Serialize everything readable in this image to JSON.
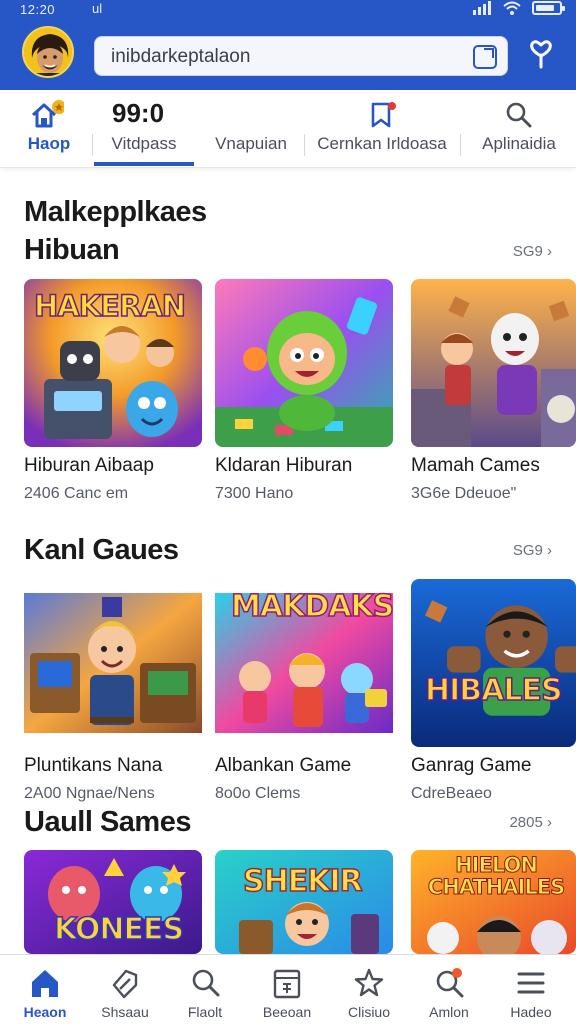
{
  "status": {
    "time": "12:20",
    "signal_left": "ul"
  },
  "search": {
    "value": "inibdarkeptalaon"
  },
  "tabs": [
    {
      "label": "Haop"
    },
    {
      "label": "Vitdpass",
      "big": "99:0"
    },
    {
      "label": "Vnapuian"
    },
    {
      "label": "Cernkan Irldoasa"
    },
    {
      "label": "Aplinaidia"
    }
  ],
  "page": {
    "title": "Malkepplkaes"
  },
  "sections": [
    {
      "title": "Hibuan",
      "see_all": "SG9 ›",
      "cards": [
        {
          "name": "Hiburan Aibaap",
          "meta": "2406 Canc em",
          "art_text": "HAKERAN"
        },
        {
          "name": "Kldaran Hiburan",
          "meta": "7300 Hano",
          "art_text": ""
        },
        {
          "name": "Mamah Cames",
          "meta": "3G6e Ddeuoe\"",
          "art_text": ""
        }
      ]
    },
    {
      "title": "Kanl Gaues",
      "see_all": "SG9 ›",
      "cards": [
        {
          "name": "Pluntikans Nana",
          "meta": "2A00 Ngnae/Nens",
          "art_text": ""
        },
        {
          "name": "Albankan Game",
          "meta": "8o0o Clems",
          "art_text": "MAKDAKS"
        },
        {
          "name": "Ganrag Game",
          "meta": "CdreBeaeo",
          "art_text": "HIBALES"
        }
      ]
    },
    {
      "title": "Uaull Sames",
      "see_all": "2805 ›",
      "cards": [
        {
          "name": "",
          "meta": "",
          "art_text": "KONEES"
        },
        {
          "name": "",
          "meta": "",
          "art_text": "SHEKIR"
        },
        {
          "name": "",
          "meta": "",
          "art_text": "HIELON CHATHAILES"
        }
      ]
    }
  ],
  "bottom_nav": [
    {
      "label": "Heaon",
      "icon": "home-icon"
    },
    {
      "label": "Shsaau",
      "icon": "tag-icon"
    },
    {
      "label": "Flaolt",
      "icon": "search-icon"
    },
    {
      "label": "Beeoan",
      "icon": "box-icon"
    },
    {
      "label": "Clisiuo",
      "icon": "star-icon"
    },
    {
      "label": "Amlon",
      "icon": "search-alert-icon"
    },
    {
      "label": "Hadeo",
      "icon": "menu-icon"
    }
  ],
  "colors": {
    "brand": "#2756c6",
    "background": "#ffffff"
  }
}
